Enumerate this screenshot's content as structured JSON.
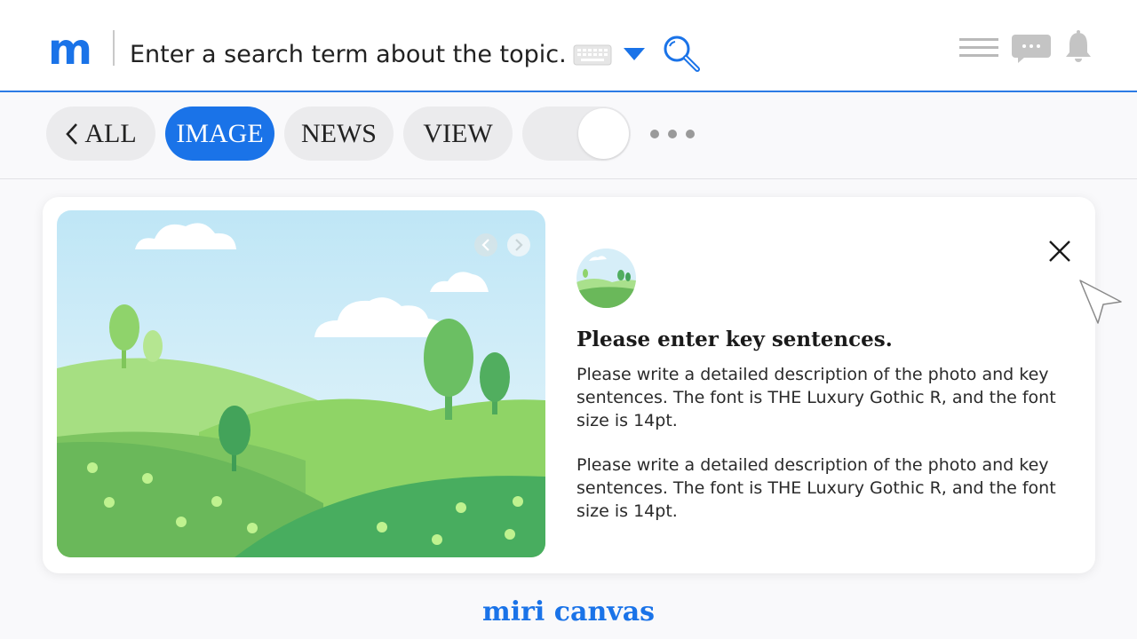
{
  "header": {
    "logo": "m",
    "search_text": "Enter a search term about the topic."
  },
  "tabs": [
    {
      "label": "ALL",
      "active": false
    },
    {
      "label": "IMAGE",
      "active": true
    },
    {
      "label": "NEWS",
      "active": false
    },
    {
      "label": "VIEW",
      "active": false
    }
  ],
  "toggle": {
    "on": true
  },
  "card": {
    "title": "Please enter key sentences.",
    "paragraphs": [
      "Please write a detailed description of the photo and key sentences. The font is THE Luxury Gothic R, and the font size is 14pt.",
      "Please write a detailed description of the photo and key sentences. The font is THE Luxury Gothic R, and the font size is 14pt."
    ]
  },
  "footer": {
    "brand": "miri canvas"
  },
  "colors": {
    "accent": "#1a73e8",
    "pill_bg": "#ebebed",
    "page_bg": "#f9f9fb"
  },
  "icons": [
    "keyboard-icon",
    "caret-down-icon",
    "search-icon",
    "menu-icon",
    "chat-icon",
    "bell-icon",
    "chevron-left-icon",
    "more-icon",
    "close-icon",
    "cursor-icon",
    "chevron-left-icon",
    "chevron-right-icon"
  ]
}
